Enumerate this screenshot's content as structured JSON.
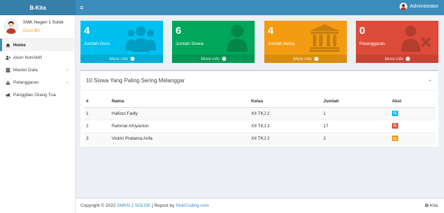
{
  "header": {
    "logo": "B-Kita",
    "toggle_icon": "≡",
    "user_name": "Administrator"
  },
  "sidebar": {
    "school": "SMK Negeri 1 Solok",
    "role": "Guru BK",
    "items": [
      {
        "label": "Home",
        "icon": "home-icon"
      },
      {
        "label": "Akun NonAktif",
        "icon": "user-times-icon"
      },
      {
        "label": "Master Data",
        "icon": "database-icon"
      },
      {
        "label": "Pelanggaran",
        "icon": "warning-icon"
      },
      {
        "label": "Panggilan Orang Tua",
        "icon": "bullhorn-icon"
      }
    ]
  },
  "tiles": [
    {
      "value": "4",
      "label": "Jumlah Guru",
      "more": "More info",
      "color": "#00c0ef",
      "icon": "users-icon"
    },
    {
      "value": "6",
      "label": "Jumlah Siswa",
      "more": "More info",
      "color": "#00a65a",
      "icon": "user-icon"
    },
    {
      "value": "4",
      "label": "Jumlah Kelas",
      "more": "More info",
      "color": "#f39c12",
      "icon": "bank-icon"
    },
    {
      "value": "0",
      "label": "Pelanggaran",
      "more": "More info",
      "color": "#dd4b39",
      "icon": "user-remove-icon"
    }
  ],
  "table_box": {
    "title": "10 Siswa Yang Paling Sering Melanggar",
    "plus": "+",
    "columns": [
      "#",
      "Nama",
      "Kelas",
      "Jumlah",
      "Aksi"
    ],
    "rows": [
      {
        "no": "1",
        "nama": "Hafizul Fadly",
        "kelas": "XII TKJ 2",
        "jumlah": "1",
        "btn_color": "#00c0ef"
      },
      {
        "no": "2",
        "nama": "Rahmat Afriyanton",
        "kelas": "XII TKJ 2",
        "jumlah": "17",
        "btn_color": "#dd4b39"
      },
      {
        "no": "3",
        "nama": "Vicktri Pratama Arifa",
        "kelas": "XII TKJ 2",
        "jumlah": "2",
        "btn_color": "#f39c12"
      }
    ]
  },
  "footer": {
    "copyright": "Copyright © 2022",
    "school_link": "SMKN 1 SOLOK",
    "repost": "| Repost by",
    "site_link": "StokCoding.com",
    "brand_bold": "B",
    "brand_rest": "-Kita"
  }
}
